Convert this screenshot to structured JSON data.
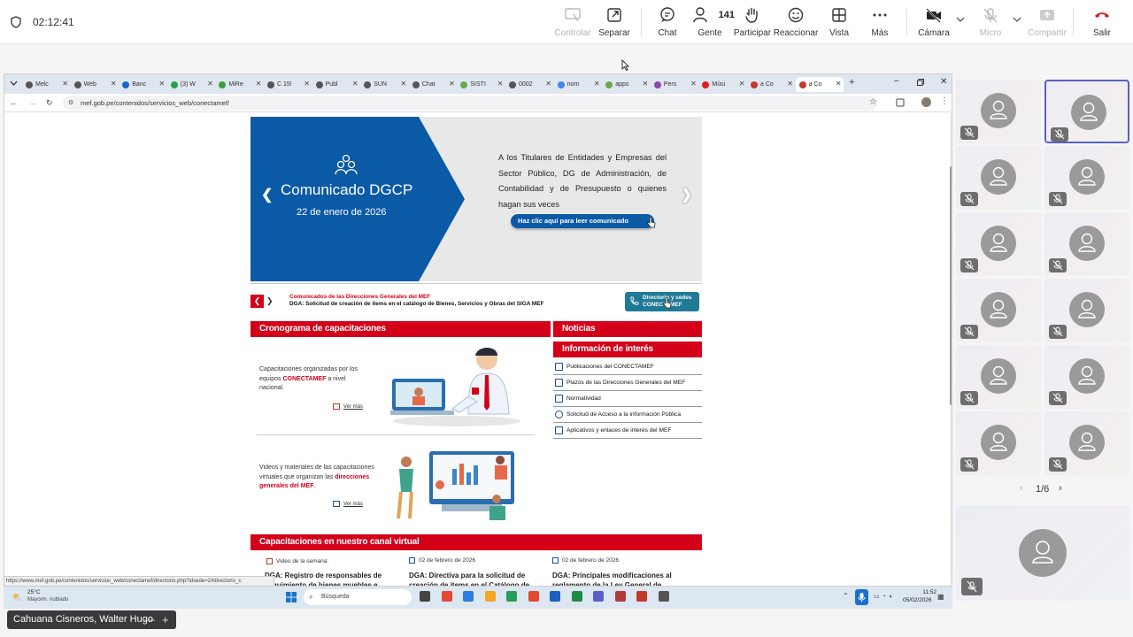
{
  "meeting": {
    "timer": "02:12:41",
    "toolbar": {
      "controlar": "Controlar",
      "separar": "Separar",
      "chat": "Chat",
      "gente": "Gente",
      "gente_count": "141",
      "participar": "Participar",
      "reaccionar": "Reaccionar",
      "vista": "Vista",
      "mas": "Más",
      "camara": "Cámara",
      "micro": "Micro",
      "compartir": "Compartir",
      "salir": "Salir"
    },
    "pager": "1/6",
    "presenter_name": "Cahuana Cisneros, Walter Hugo"
  },
  "browser": {
    "tabs": [
      {
        "label": "Melc",
        "color": "#555555"
      },
      {
        "label": "Web",
        "color": "#555555"
      },
      {
        "label": "Banc",
        "color": "#1a66c2"
      },
      {
        "label": "(3) W",
        "color": "#25a244"
      },
      {
        "label": "MiRe",
        "color": "#3b9d3b"
      },
      {
        "label": "C 15!",
        "color": "#555555"
      },
      {
        "label": "Publ",
        "color": "#555555"
      },
      {
        "label": "SUN",
        "color": "#555555"
      },
      {
        "label": "Chat",
        "color": "#555555"
      },
      {
        "label": "SISTI",
        "color": "#6aa84f"
      },
      {
        "label": "0002",
        "color": "#555555"
      },
      {
        "label": "nom",
        "color": "#4285f4"
      },
      {
        "label": "apps",
        "color": "#6aa84f"
      },
      {
        "label": "Pers",
        "color": "#8e44ad"
      },
      {
        "label": "Músi",
        "color": "#e02020"
      },
      {
        "label": "a Co",
        "color": "#c0392b"
      },
      {
        "label": "a Co",
        "color": "#c0392b"
      }
    ],
    "url": "mef.gob.pe/contenidos/servicios_web/conectamef/",
    "status_url": "https://www.mef.gob.pe/contenidos/servicios_web/conectamef/directorio.php?idsede=2#directorio_c"
  },
  "page": {
    "banner": {
      "title": "Comunicado DGCP",
      "date": "22 de enero de 2026",
      "text": "A los Titulares de Entidades y Empresas del Sector Público, DG de Administración, de Contabilidad y de Presupuesto o quienes hagan sus veces",
      "cta": "Haz clic aquí para leer comunicado"
    },
    "ticker": {
      "source": "Comunicados de las Direcciones Generales del MEF",
      "text": "DGA: Solicitud de creación de ítems en el catálogo de Bienes, Servicios y Obras del SIGA MEF",
      "directory_btn": "Directorio y sedes CONECTAMEF"
    },
    "cronograma": {
      "header": "Cronograma de capacitaciones",
      "item1_pre": "Capacitaciones organizadas por los equipos",
      "item1_hl": "CONECTAMEF",
      "item1_post": "a nivel nacional.",
      "vermas": "Ver más",
      "item2_pre": "Videos y materiales de las capacitaciones virtuales que organizan las",
      "item2_hl": "direcciones generales del MEF",
      "item2_post": "."
    },
    "noticias": "Noticias",
    "info": {
      "header": "Información de interés",
      "links": [
        "Publicaciones del CONECTAMEF",
        "Plazos de las Direcciones Generales del MEF",
        "Normatividad",
        "Solicitud de Acceso a la información Pública",
        "Aplicativos y enlaces de interés del MEF"
      ]
    },
    "canal": {
      "header": "Capacitaciones en nuestro canal virtual",
      "video_label": "Video de la semana:",
      "col1": "DGA: Registro de responsables de seguimiento de bienes muebles e",
      "col2_date": "02 de febrero de 2026",
      "col2": "DGA: Directiva para la solicitud de creación de ítems en el Catálogo de",
      "col3_date": "02 de febrero de 2026",
      "col3": "DGA: Principales modificaciones al reglamento de la Ley General de"
    }
  },
  "taskbar": {
    "weather_temp": "25°C",
    "weather_desc": "Mayorm. nublado",
    "search": "Búsqueda",
    "time": "11:52",
    "date": "05/02/2026"
  }
}
